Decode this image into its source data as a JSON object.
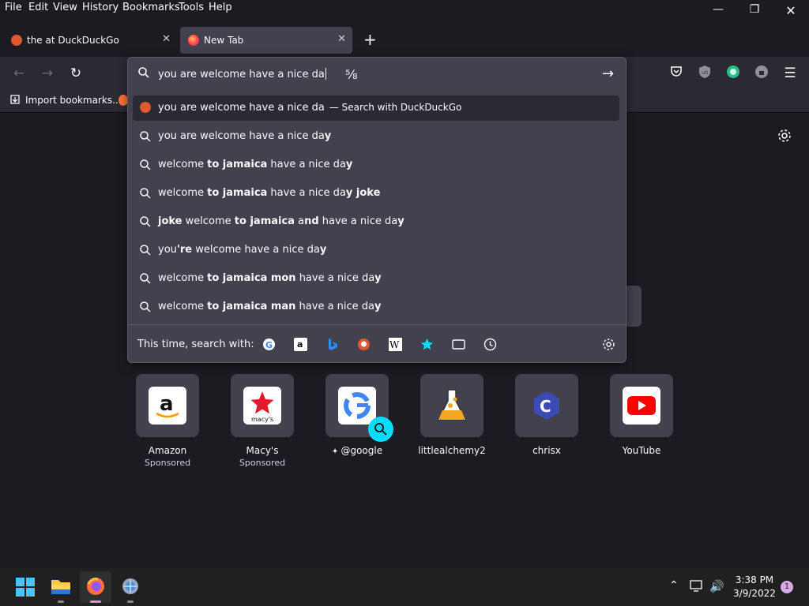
{
  "menu": [
    "File",
    "Edit",
    "View",
    "History",
    "Bookmarks",
    "Tools",
    "Help"
  ],
  "tabs": [
    {
      "title": "the at DuckDuckGo",
      "active": false
    },
    {
      "title": "New Tab",
      "active": true
    }
  ],
  "urlbar": {
    "value": "you are welcome have a nice da"
  },
  "bookmarks": {
    "import_label": "Import bookmarks..."
  },
  "suggestions": {
    "first": {
      "text": "you are welcome have a nice da",
      "suffix": "— Search with DuckDuckGo"
    },
    "items": [
      {
        "parts": [
          [
            "you are welcome have a nice da",
            false
          ],
          [
            "y",
            true
          ]
        ]
      },
      {
        "parts": [
          [
            "welcome ",
            false
          ],
          [
            "to jamaica",
            true
          ],
          [
            " have a nice da",
            false
          ],
          [
            "y",
            true
          ]
        ]
      },
      {
        "parts": [
          [
            "welcome ",
            false
          ],
          [
            "to jamaica",
            true
          ],
          [
            " have a nice da",
            false
          ],
          [
            "y joke",
            true
          ]
        ]
      },
      {
        "parts": [
          [
            "joke",
            true
          ],
          [
            " welcome ",
            false
          ],
          [
            "to jamaica",
            true
          ],
          [
            " a",
            false
          ],
          [
            "nd",
            true
          ],
          [
            " have a nice da",
            false
          ],
          [
            "y",
            true
          ]
        ]
      },
      {
        "parts": [
          [
            "you",
            false
          ],
          [
            "'re",
            true
          ],
          [
            " welcome have a nice da",
            false
          ],
          [
            "y",
            true
          ]
        ]
      },
      {
        "parts": [
          [
            "welcome ",
            false
          ],
          [
            "to jamaica mon",
            true
          ],
          [
            " have a nice da",
            false
          ],
          [
            "y",
            true
          ]
        ]
      },
      {
        "parts": [
          [
            "welcome ",
            false
          ],
          [
            "to jamaica man",
            true
          ],
          [
            " have a nice da",
            false
          ],
          [
            "y",
            true
          ]
        ]
      }
    ]
  },
  "search_with": {
    "label": "This time, search with:"
  },
  "shortcuts": [
    {
      "name": "Amazon",
      "sub": "Sponsored"
    },
    {
      "name": "Macy's",
      "sub": "Sponsored"
    },
    {
      "name": "@google",
      "sub": ""
    },
    {
      "name": "littlealchemy2",
      "sub": ""
    },
    {
      "name": "chrisx",
      "sub": ""
    },
    {
      "name": "YouTube",
      "sub": ""
    }
  ],
  "taskbar": {
    "time": "3:38 PM",
    "date": "3/9/2022",
    "notification_count": "1"
  },
  "colors": {
    "accent": "#00ddff",
    "background": "#1c1b22",
    "toolbar": "#2b2a33",
    "panel": "#42414d"
  }
}
